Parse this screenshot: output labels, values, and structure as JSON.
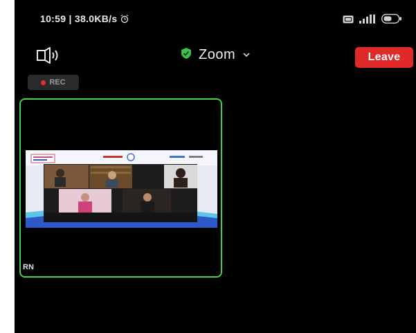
{
  "status_bar": {
    "time_speed": "10:59 | 38.0KB/s",
    "alarm_icon": "alarm-icon",
    "sim_icon": "sim-card-icon",
    "signal_icon": "signal-icon",
    "battery_icon": "battery-icon"
  },
  "header": {
    "speaker_icon": "speaker-icon",
    "shield_icon": "shield-check-icon",
    "title": "Zoom",
    "chevron_icon": "chevron-down-icon",
    "leave_label": "Leave"
  },
  "recording": {
    "label": "REC"
  },
  "video_tile": {
    "name": "RN",
    "active_speaker_color": "#44d24a"
  },
  "colors": {
    "background": "#000000",
    "leave_button": "#e02a2a",
    "shield": "#3ec14b",
    "rec_dot": "#e53030"
  }
}
